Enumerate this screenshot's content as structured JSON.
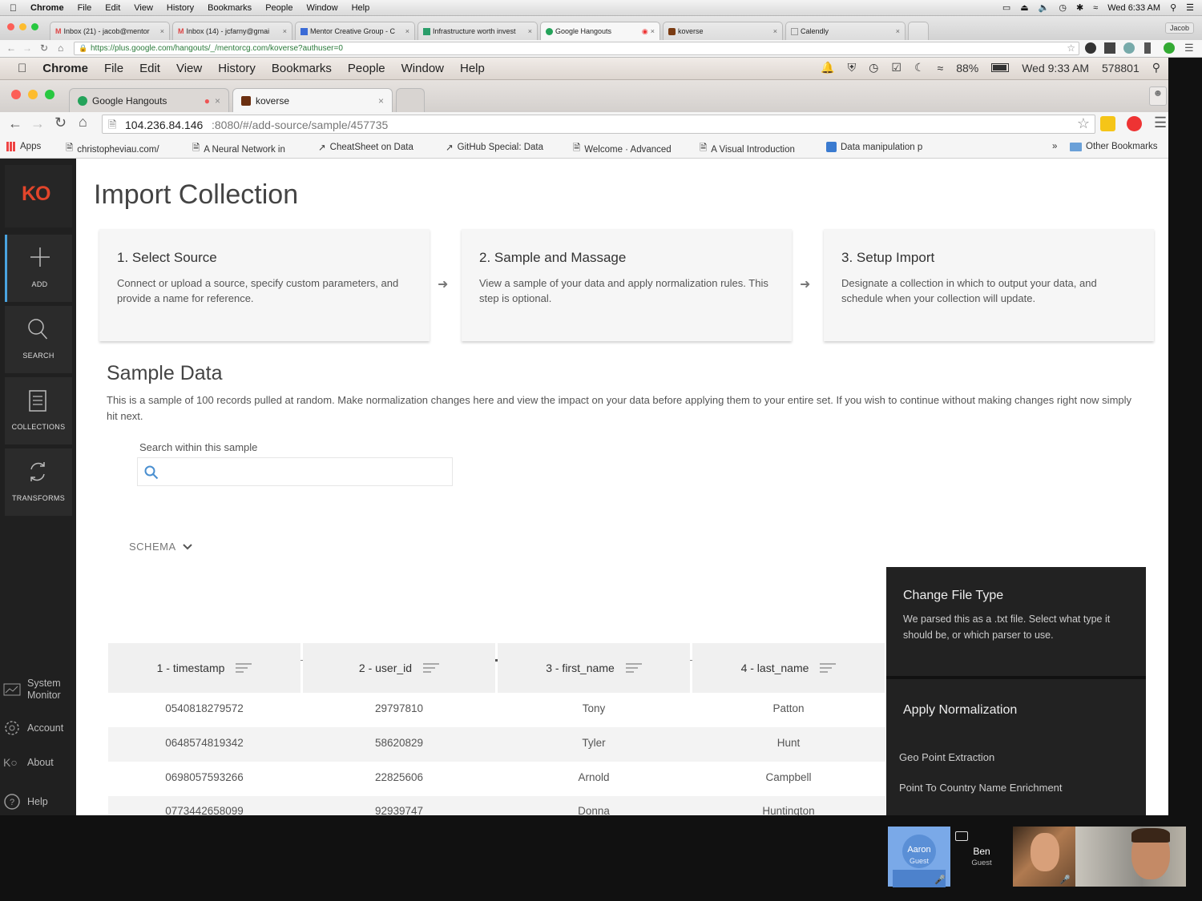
{
  "outer_menubar": {
    "app": "Chrome",
    "items": [
      "File",
      "Edit",
      "View",
      "History",
      "Bookmarks",
      "People",
      "Window",
      "Help"
    ],
    "clock": "Wed 6:33 AM"
  },
  "outer_tabs": [
    {
      "label": "Inbox (21) - jacob@mentor"
    },
    {
      "label": "Inbox (14) - jcfarny@gmai"
    },
    {
      "label": "Mentor Creative Group - C"
    },
    {
      "label": "Infrastructure worth invest"
    },
    {
      "label": "Google Hangouts"
    },
    {
      "label": "koverse"
    },
    {
      "label": "Calendly"
    }
  ],
  "outer_profile": "Jacob",
  "outer_url": "https://plus.google.com/hangouts/_/mentorcg.com/koverse?authuser=0",
  "inner_menubar": {
    "app": "Chrome",
    "items": [
      "File",
      "Edit",
      "View",
      "History",
      "Bookmarks",
      "People",
      "Window",
      "Help"
    ],
    "battery": "88%",
    "clock": "Wed 9:33 AM",
    "counter": "578801"
  },
  "inner_tabs": [
    {
      "label": "Google Hangouts"
    },
    {
      "label": "koverse"
    }
  ],
  "inner_url_host": "104.236.84.146",
  "inner_url_rest": ":8080/#/add-source/sample/457735",
  "bookmarks": [
    "Apps",
    "christopheviau.com/",
    "A Neural Network in",
    "CheatSheet on Data",
    "GitHub Special: Data",
    "Welcome · Advanced",
    "A Visual Introduction",
    "Data manipulation p"
  ],
  "bookmarks_more": "»",
  "bookmarks_other": "Other Bookmarks",
  "sidebar": {
    "logo": "KO",
    "items": [
      {
        "label": "ADD"
      },
      {
        "label": "SEARCH"
      },
      {
        "label": "COLLECTIONS"
      },
      {
        "label": "TRANSFORMS"
      }
    ],
    "bottom": [
      {
        "label": "System Monitor"
      },
      {
        "label": "Account"
      },
      {
        "label": "About"
      },
      {
        "label": "Help"
      }
    ]
  },
  "page_title": "Import Collection",
  "steps": [
    {
      "title": "1. Select Source",
      "desc": "Connect or upload a source, specify custom parameters, and provide a name for reference."
    },
    {
      "title": "2. Sample and Massage",
      "desc": "View a sample of your data and apply normalization rules. This step is optional."
    },
    {
      "title": "3. Setup Import",
      "desc": "Designate a collection in which to output your data, and schedule when your collection will update."
    }
  ],
  "sample_title": "Sample Data",
  "sample_desc": "This is a sample of 100 records pulled at random. Make normalization changes here and view the impact on your data before applying them to your entire set. If you wish to continue without making changes right now simply hit next.",
  "search_label": "Search within this sample",
  "schema_label": "SCHEMA",
  "table": {
    "columns": [
      "1 - timestamp",
      "2 - user_id",
      "3 - first_name",
      "4 - last_name"
    ],
    "rows": [
      [
        "0540818279572",
        "29797810",
        "Tony",
        "Patton"
      ],
      [
        "0648574819342",
        "58620829",
        "Tyler",
        "Hunt"
      ],
      [
        "0698057593266",
        "22825606",
        "Arnold",
        "Campbell"
      ],
      [
        "0773442658099",
        "92939747",
        "Donna",
        "Huntington"
      ]
    ]
  },
  "panel": {
    "title": "Change File Type",
    "desc": "We parsed this as a .txt file. Select what type it should be, or which parser to use.",
    "norm_title": "Apply Normalization",
    "norm_items": [
      "Geo Point Extraction",
      "Point To Country Name Enrichment"
    ]
  },
  "video": {
    "participants": [
      {
        "name": "Aaron",
        "role": "Guest"
      },
      {
        "name": "Ben",
        "role": "Guest"
      }
    ]
  }
}
